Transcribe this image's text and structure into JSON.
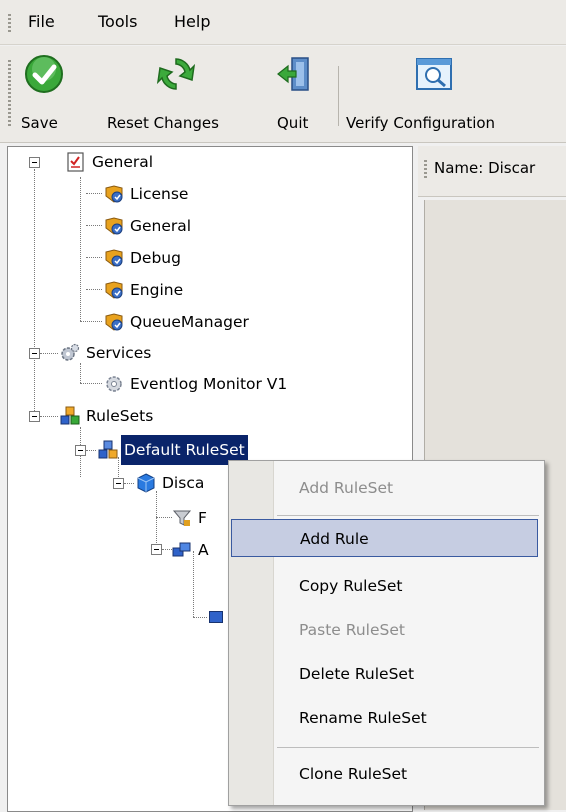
{
  "menu": [
    "File",
    "Tools",
    "Help"
  ],
  "toolbar": {
    "save": "Save",
    "reset": "Reset Changes",
    "quit": "Quit",
    "verify": "Verify Configuration"
  },
  "right_header": {
    "name_label": "Name: Discar"
  },
  "tree": {
    "general": "General",
    "license": "License",
    "general_child": "General",
    "debug": "Debug",
    "engine": "Engine",
    "queue_manager": "QueueManager",
    "services": "Services",
    "eventlog": "Eventlog Monitor V1",
    "rulesets": "RuleSets",
    "default_ruleset": "Default RuleSet",
    "discard": "Disca",
    "filter_partial": "F",
    "actions_partial": "A"
  },
  "context_menu": {
    "items": [
      {
        "label": "Add RuleSet",
        "enabled": false
      },
      {
        "label": "Add Rule",
        "enabled": true,
        "highlighted": true
      },
      {
        "label": "Copy RuleSet",
        "enabled": true
      },
      {
        "label": "Paste RuleSet",
        "enabled": false
      },
      {
        "label": "Delete RuleSet",
        "enabled": true
      },
      {
        "label": "Rename RuleSet",
        "enabled": true
      },
      {
        "label": "Clone RuleSet",
        "enabled": true
      }
    ]
  },
  "colors": {
    "selection": "#0a246a",
    "menu_highlight": "#c6cde2",
    "disabled_text": "#8d8d8d"
  }
}
